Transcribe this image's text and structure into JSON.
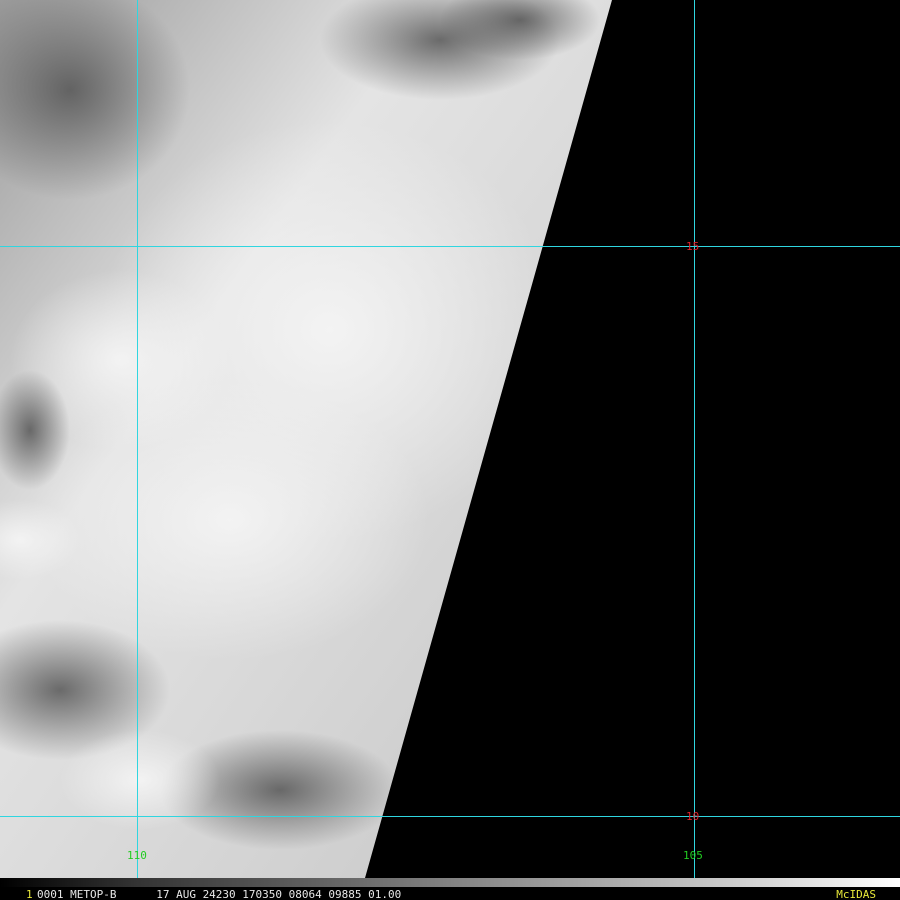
{
  "colors": {
    "gridline": "#2fd6e0",
    "lat_label": "#e0202a",
    "lon_label": "#22cc22",
    "brand": "#e8e83a",
    "background": "#000000"
  },
  "grid": {
    "latitudes": [
      {
        "label": "15"
      },
      {
        "label": "10"
      }
    ],
    "longitudes": [
      {
        "label": "110"
      },
      {
        "label": "105"
      }
    ]
  },
  "footer": {
    "frame_number": "1",
    "info": "0001 METOP-B      17 AUG 24230 170350 08064 09885 01.00",
    "brand": "McIDAS"
  }
}
